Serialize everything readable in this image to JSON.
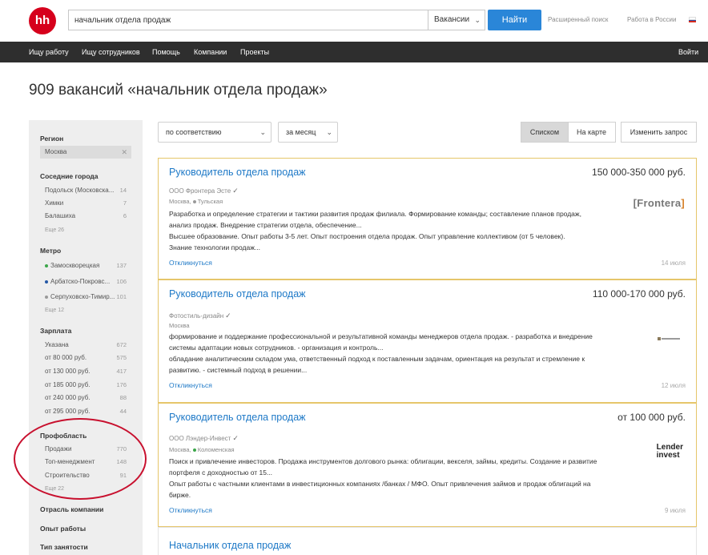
{
  "header": {
    "logo_text": "hh",
    "search_value": "начальник отдела продаж",
    "scope_selected": "Вакансии",
    "find_button": "Найти",
    "advanced_search": "Расширенный поиск",
    "region_link": "Работа в России"
  },
  "nav": {
    "items": [
      "Ищу работу",
      "Ищу сотрудников",
      "Помощь",
      "Компании",
      "Проекты"
    ],
    "login": "Войти"
  },
  "page_title": "909 вакансий «начальник отдела продаж»",
  "sidebar": {
    "region_heading": "Регион",
    "region_value": "Москва",
    "cities_heading": "Соседние города",
    "cities": [
      {
        "label": "Подольск (Московска...",
        "count": "14"
      },
      {
        "label": "Химки",
        "count": "7"
      },
      {
        "label": "Балашиха",
        "count": "6"
      }
    ],
    "cities_more": "Еще 26",
    "metro_heading": "Метро",
    "metro": [
      {
        "label": "Замоскворецкая",
        "count": "137",
        "color": "#3ca64a"
      },
      {
        "label": "Арбатско-Покровс...",
        "count": "106",
        "color": "#2458a6"
      },
      {
        "label": "Серпуховско-Тимир...",
        "count": "101",
        "color": "#9a9a9a"
      }
    ],
    "metro_more": "Еще 12",
    "salary_heading": "Зарплата",
    "salary": [
      {
        "label": "Указана",
        "count": "672"
      },
      {
        "label": "от 80 000 руб.",
        "count": "575"
      },
      {
        "label": "от 130 000 руб.",
        "count": "417"
      },
      {
        "label": "от 185 000 руб.",
        "count": "176"
      },
      {
        "label": "от 240 000 руб.",
        "count": "88"
      },
      {
        "label": "от 295 000 руб.",
        "count": "44"
      }
    ],
    "prof_heading": "Профобласть",
    "prof": [
      {
        "label": "Продажи",
        "count": "770"
      },
      {
        "label": "Топ-менеджмент",
        "count": "148"
      },
      {
        "label": "Строительство",
        "count": "91"
      }
    ],
    "prof_more": "Еще 22",
    "industry_heading": "Отрасль компании",
    "experience_heading": "Опыт работы",
    "employment_heading": "Тип занятости"
  },
  "toolbar": {
    "sort_selected": "по соответствию",
    "period_selected": "за месяц",
    "list_view": "Списком",
    "map_view": "На карте",
    "edit_query": "Изменить запрос"
  },
  "vacancies": [
    {
      "title": "Руководитель отдела продаж",
      "salary": "150 000-350 000 руб.",
      "company": "ООО Фронтера Эсте",
      "location": "Москва,",
      "metro": "Тульская",
      "metro_color": "#9a9a9a",
      "line1": "Разработка и определение стратегии и тактики развития продаж филиала. Формирование команды; составление планов продаж,",
      "line2": "анализ продаж. Внедрение стратегии отдела, обеспечение...",
      "line3": "Высшее образование. Опыт работы 3-5 лет. Опыт построения отдела продаж. Опыт управление коллективом (от 5 человек).",
      "line4": "Знание технологии продаж...",
      "respond": "Откликнуться",
      "date": "14 июля",
      "logo_text_a": "[Frontera",
      "logo_text_b": "]"
    },
    {
      "title": "Руководитель отдела продаж",
      "salary": "110 000-170 000 руб.",
      "company": "Фотостиль-дизайн",
      "location": "Москва",
      "line1": "формирование и поддержание профессиональной и результативной команды менеджеров отдела продаж. - разработка и внедрение",
      "line2": "системы адаптации новых сотрудников. - организация и контроль...",
      "line3": "обладание аналитическим складом ума, ответственный подход к поставленным задачам, ориентация на результат и стремление к",
      "line4": "развитию. - системный подход в решении...",
      "respond": "Откликнуться",
      "date": "12 июля"
    },
    {
      "title": "Руководитель отдела продаж",
      "salary": "от 100 000 руб.",
      "company": "ООО Лэндер-Инвест",
      "location": "Москва,",
      "metro": "Коломенская",
      "metro_color": "#3ca64a",
      "line1": "Поиск и привлечение инвесторов. Продажа инструментов долгового рынка: облигации, векселя, займы, кредиты. Создание и развитие",
      "line2": "портфеля с доходностью от 15...",
      "line3": "Опыт работы с частными клиентами в инвестиционных компаниях /банках / МФО. Опыт привлечения займов и продаж облигаций на",
      "line4": "бирже.",
      "respond": "Откликнуться",
      "date": "9 июля",
      "logo_text_a": "Lender",
      "logo_text_b": "invest"
    },
    {
      "title": "Начальник отдела продаж"
    }
  ],
  "colors": {
    "brand": "#d6001c",
    "link": "#1e79c7",
    "find_button": "#2a86d8",
    "highlight_border": "#e6c66a",
    "annotation": "#c8102e"
  }
}
